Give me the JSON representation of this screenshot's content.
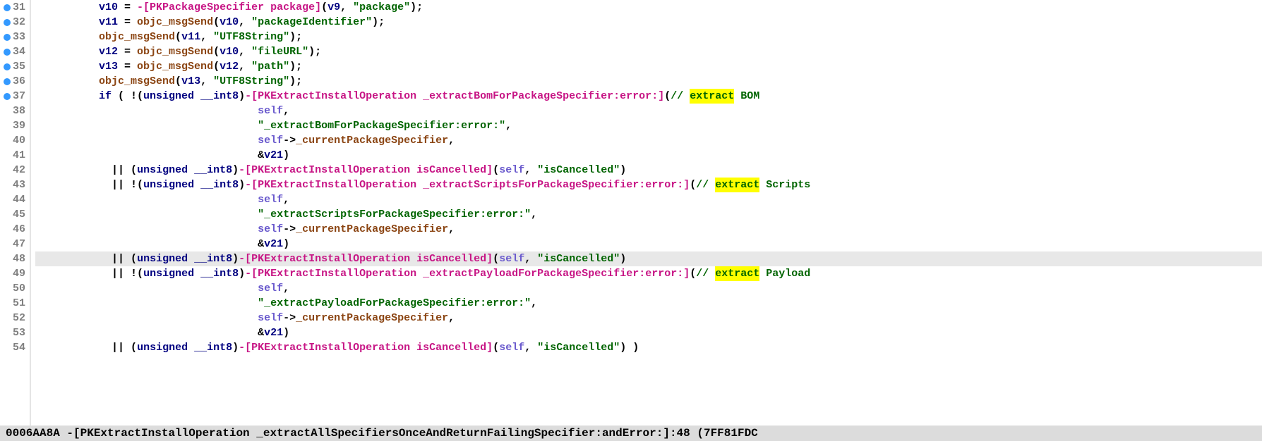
{
  "gutter": {
    "lines": [
      {
        "num": "31",
        "bp": true
      },
      {
        "num": "32",
        "bp": true
      },
      {
        "num": "33",
        "bp": true
      },
      {
        "num": "34",
        "bp": true
      },
      {
        "num": "35",
        "bp": true
      },
      {
        "num": "36",
        "bp": true
      },
      {
        "num": "37",
        "bp": true
      },
      {
        "num": "38",
        "bp": false
      },
      {
        "num": "39",
        "bp": false
      },
      {
        "num": "40",
        "bp": false
      },
      {
        "num": "41",
        "bp": false
      },
      {
        "num": "42",
        "bp": false
      },
      {
        "num": "43",
        "bp": false
      },
      {
        "num": "44",
        "bp": false
      },
      {
        "num": "45",
        "bp": false
      },
      {
        "num": "46",
        "bp": false
      },
      {
        "num": "47",
        "bp": false
      },
      {
        "num": "48",
        "bp": false
      },
      {
        "num": "49",
        "bp": false
      },
      {
        "num": "50",
        "bp": false
      },
      {
        "num": "51",
        "bp": false
      },
      {
        "num": "52",
        "bp": false
      },
      {
        "num": "53",
        "bp": false
      },
      {
        "num": "54",
        "bp": false
      }
    ]
  },
  "code": {
    "l31": {
      "indent": "          ",
      "v10": "v10",
      "eq": " = ",
      "call": "-[PKPackageSpecifier package]",
      "open": "(",
      "v9": "v9",
      "comma": ", ",
      "str": "\"package\"",
      "close": ");"
    },
    "l32": {
      "indent": "          ",
      "v11": "v11",
      "eq": " = ",
      "fn": "objc_msgSend",
      "open": "(",
      "v10": "v10",
      "comma": ", ",
      "str": "\"packageIdentifier\"",
      "close": ");"
    },
    "l33": {
      "indent": "          ",
      "fn": "objc_msgSend",
      "open": "(",
      "v11": "v11",
      "comma": ", ",
      "str": "\"UTF8String\"",
      "close": ");"
    },
    "l34": {
      "indent": "          ",
      "v12": "v12",
      "eq": " = ",
      "fn": "objc_msgSend",
      "open": "(",
      "v10": "v10",
      "comma": ", ",
      "str": "\"fileURL\"",
      "close": ");"
    },
    "l35": {
      "indent": "          ",
      "v13": "v13",
      "eq": " = ",
      "fn": "objc_msgSend",
      "open": "(",
      "v12": "v12",
      "comma": ", ",
      "str": "\"path\"",
      "close": ");"
    },
    "l36": {
      "indent": "          ",
      "fn": "objc_msgSend",
      "open": "(",
      "v13": "v13",
      "comma": ", ",
      "str": "\"UTF8String\"",
      "close": ");"
    },
    "l37": {
      "indent": "          ",
      "if": "if",
      "open": " ( !(",
      "cast": "unsigned __int8",
      "close1": ")",
      "call": "-[PKExtractInstallOperation _extractBomForPackageSpecifier:error:]",
      "open2": "(",
      "comment": "// ",
      "hl": "extract",
      "tail": " BOM"
    },
    "l38": {
      "indent": "                                   ",
      "self": "self",
      "comma": ","
    },
    "l39": {
      "indent": "                                   ",
      "str": "\"_extractBomForPackageSpecifier:error:\"",
      "comma": ","
    },
    "l40": {
      "indent": "                                   ",
      "self": "self",
      "arrow": "->",
      "member": "_currentPackageSpecifier",
      "comma": ","
    },
    "l41": {
      "indent": "                                   ",
      "amp": "&",
      "v21": "v21",
      "close": ")"
    },
    "l42": {
      "indent": "            ",
      "or": "|| ",
      "open": "(",
      "cast": "unsigned __int8",
      "close": ")",
      "call": "-[PKExtractInstallOperation isCancelled]",
      "open2": "(",
      "self": "self",
      "comma": ", ",
      "str": "\"isCancelled\"",
      "close2": ")"
    },
    "l43": {
      "indent": "            ",
      "or": "|| !",
      "open": "(",
      "cast": "unsigned __int8",
      "close": ")",
      "call": "-[PKExtractInstallOperation _extractScriptsForPackageSpecifier:error:]",
      "open2": "(",
      "comment": "// ",
      "hl": "extract",
      "tail": " Scripts"
    },
    "l44": {
      "indent": "                                   ",
      "self": "self",
      "comma": ","
    },
    "l45": {
      "indent": "                                   ",
      "str": "\"_extractScriptsForPackageSpecifier:error:\"",
      "comma": ","
    },
    "l46": {
      "indent": "                                   ",
      "self": "self",
      "arrow": "->",
      "member": "_currentPackageSpecifier",
      "comma": ","
    },
    "l47": {
      "indent": "                                   ",
      "amp": "&",
      "v21": "v21",
      "close": ")"
    },
    "l48": {
      "indent": "            ",
      "or": "|| ",
      "open": "(",
      "cast": "unsigned __int8",
      "close": ")",
      "call": "-[PKExtractInstallOperation isCancelled]",
      "open2": "(",
      "self": "self",
      "comma": ", ",
      "str": "\"isCancelled\"",
      "close2": ")"
    },
    "l49": {
      "indent": "            ",
      "or": "|| !",
      "open": "(",
      "cast": "unsigned __int8",
      "close": ")",
      "call": "-[PKExtractInstallOperation _extractPayloadForPackageSpecifier:error:]",
      "open2": "(",
      "comment": "// ",
      "hl": "extract",
      "tail": " Payload"
    },
    "l50": {
      "indent": "                                   ",
      "self": "self",
      "comma": ","
    },
    "l51": {
      "indent": "                                   ",
      "str": "\"_extractPayloadForPackageSpecifier:error:\"",
      "comma": ","
    },
    "l52": {
      "indent": "                                   ",
      "self": "self",
      "arrow": "->",
      "member": "_currentPackageSpecifier",
      "comma": ","
    },
    "l53": {
      "indent": "                                   ",
      "amp": "&",
      "v21": "v21",
      "close": ")"
    },
    "l54": {
      "indent": "            ",
      "or": "|| ",
      "open": "(",
      "cast": "unsigned __int8",
      "close": ")",
      "call": "-[PKExtractInstallOperation isCancelled]",
      "open2": "(",
      "self": "self",
      "comma": ", ",
      "str": "\"isCancelled\"",
      "close2": ") )"
    }
  },
  "status": "0006AA8A -[PKExtractInstallOperation _extractAllSpecifiersOnceAndReturnFailingSpecifier:andError:]:48 (7FF81FDC",
  "current_line": 48
}
